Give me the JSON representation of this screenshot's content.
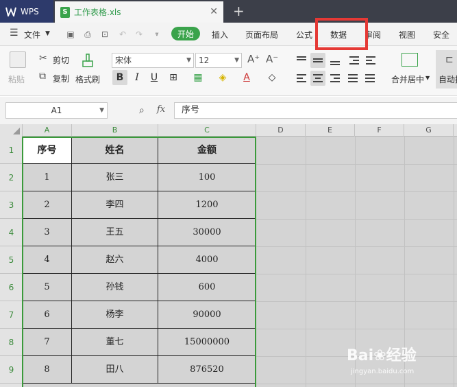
{
  "app": {
    "name": "WPS",
    "doc_tab": "工作表格.xls",
    "doc_icon": "S",
    "new_tab_symbol": "+"
  },
  "menu": {
    "file": "文件",
    "start": "开始",
    "insert": "插入",
    "page_layout": "页面布局",
    "formula": "公式",
    "data": "数据",
    "review": "审阅",
    "view": "视图",
    "security": "安全"
  },
  "ribbon": {
    "paste": "粘贴",
    "cut": "剪切",
    "copy": "复制",
    "format_painter": "格式刷",
    "font_name": "宋体",
    "font_size": "12",
    "merge_center": "合并居中",
    "auto_wrap": "自动换"
  },
  "formula_bar": {
    "name_box": "A1",
    "fx": "fx",
    "value": "序号"
  },
  "grid": {
    "columns": [
      "A",
      "B",
      "C",
      "D",
      "E",
      "F",
      "G"
    ],
    "rows": [
      "1",
      "2",
      "3",
      "4",
      "5",
      "6",
      "7",
      "8",
      "9"
    ],
    "table": [
      [
        "序号",
        "姓名",
        "金额"
      ],
      [
        "1",
        "张三",
        "100"
      ],
      [
        "2",
        "李四",
        "1200"
      ],
      [
        "3",
        "王五",
        "30000"
      ],
      [
        "4",
        "赵六",
        "4000"
      ],
      [
        "5",
        "孙钱",
        "600"
      ],
      [
        "6",
        "杨李",
        "90000"
      ],
      [
        "7",
        "董七",
        "15000000"
      ],
      [
        "8",
        "田八",
        "876520"
      ]
    ]
  },
  "watermark": {
    "main": "Bai❀经验",
    "sub": "jingyan.baidu.com"
  },
  "colors": {
    "accent_green": "#3aa34b",
    "highlight_red": "#e53935",
    "title_bg": "#3c3f49"
  }
}
